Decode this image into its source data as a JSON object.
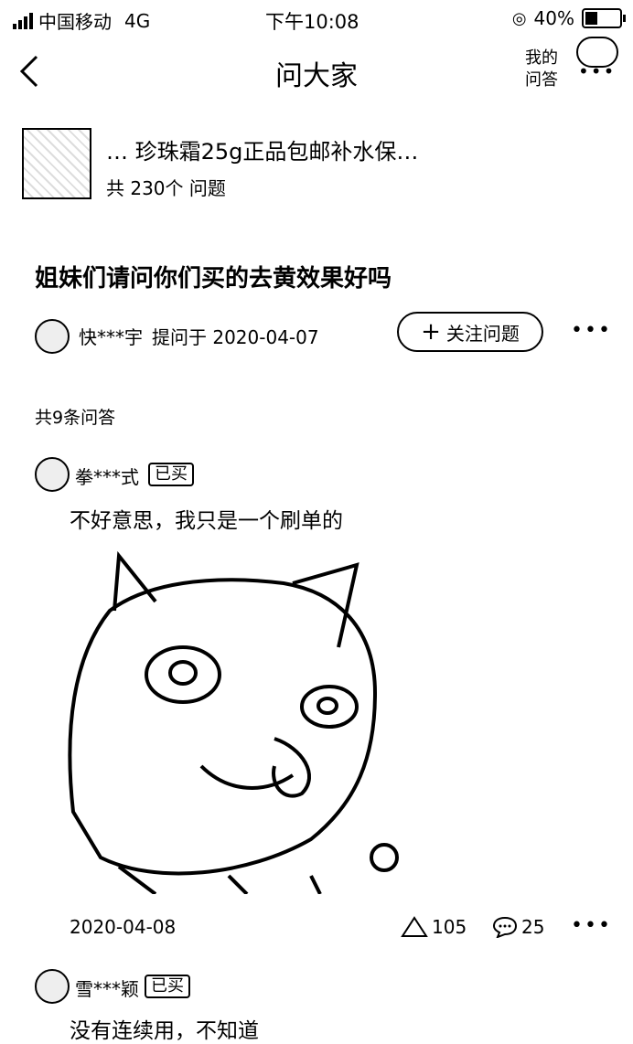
{
  "status_bar": {
    "carrier": "中国移动",
    "network": "4G",
    "time": "下午10:08",
    "battery_percent": "40%",
    "battery_level": 0.4
  },
  "nav": {
    "back_icon": "chevron-left-icon",
    "title": "问大家",
    "my_answers_line1": "我的",
    "my_answers_line2": "问答"
  },
  "product": {
    "title": "… 珍珠霜25g正品包邮补水保…",
    "question_count": "共 230个 问题"
  },
  "question": {
    "text": "姐妹们请问你们买的去黄效果好吗",
    "asker": "快***宇",
    "asked_at": "提问于 2020-04-07",
    "follow_label": "关注问题"
  },
  "answers_total": "共9条问答",
  "answers": [
    {
      "user": "拳***式",
      "badge": "已买",
      "text": "不好意思，我只是一个刷单的",
      "date": "2020-04-08",
      "likes": "105",
      "comments": "25"
    },
    {
      "user": "雪***颖",
      "badge": "已买",
      "text": "没有连续用，不知道"
    }
  ]
}
